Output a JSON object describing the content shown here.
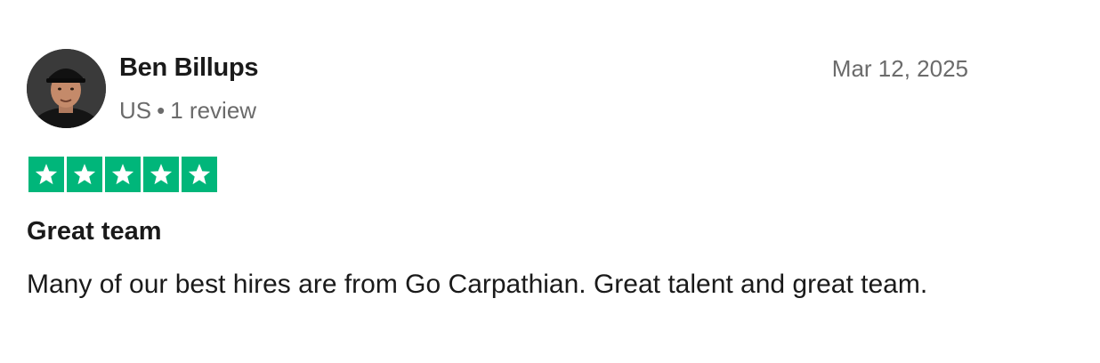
{
  "reviewer": {
    "name": "Ben Billups",
    "country": "US",
    "separator": "•",
    "review_count": "1 review"
  },
  "review": {
    "date": "Mar 12, 2025",
    "rating": 5,
    "rating_max": 5,
    "star_color": "#00b67a",
    "title": "Great team",
    "body": "Many of our best hires are from Go Carpathian. Great talent and great team."
  },
  "icons": {
    "avatar": "avatar-photo",
    "star": "star-icon"
  }
}
